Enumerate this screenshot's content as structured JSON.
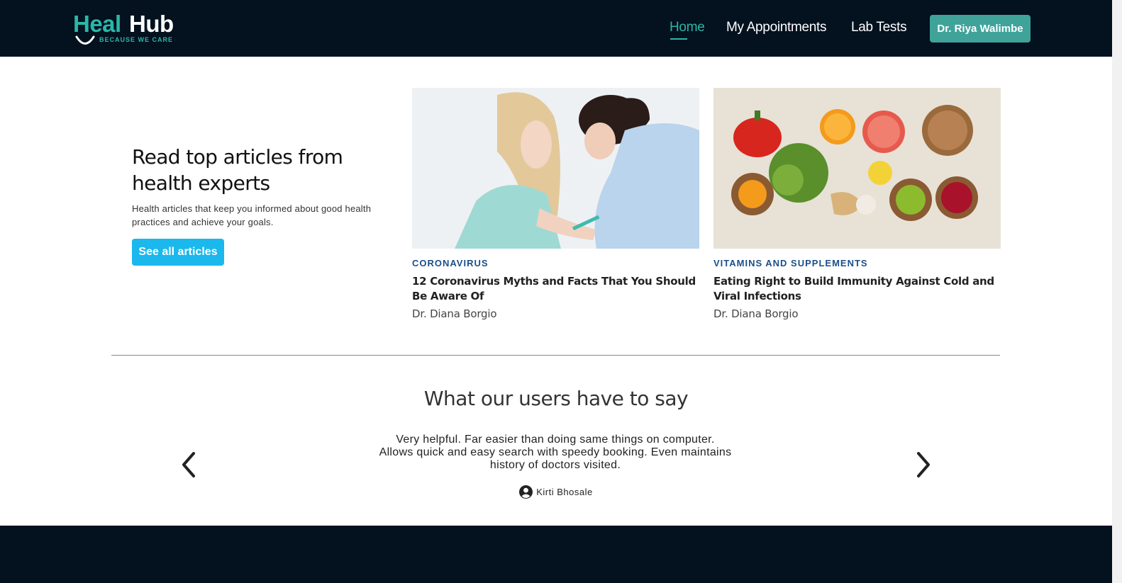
{
  "brand": {
    "name_part1": "Heal",
    "name_part2": "Hub",
    "tagline": "BECAUSE WE CARE",
    "accent_color": "#2bb7a8",
    "dark_color": "#04111f"
  },
  "nav": {
    "items": [
      {
        "label": "Home",
        "active": true
      },
      {
        "label": "My Appointments",
        "active": false
      },
      {
        "label": "Lab Tests",
        "active": false
      }
    ],
    "user_button": "Dr. Riya Walimbe"
  },
  "articles_intro": {
    "title": "Read top articles from health experts",
    "subtitle": "Health articles that keep you informed about good health practices and achieve your goals.",
    "button": "See all articles",
    "button_color": "#1ab8ec"
  },
  "articles": [
    {
      "category": "CORONAVIRUS",
      "title": "12 Coronavirus Myths and Facts That You Should Be Aware Of",
      "author": "Dr. Diana Borgio",
      "image": "nurse-vaccinating-patient-photo"
    },
    {
      "category": "VITAMINS AND SUPPLEMENTS",
      "title": "Eating Right to Build Immunity Against Cold and Viral Infections",
      "author": "Dr. Diana Borgio",
      "image": "healthy-foods-photo"
    }
  ],
  "testimonials": {
    "title": "What our users have to say",
    "quote": "Very helpful. Far easier than doing same things on computer. Allows quick and easy search with speedy booking. Even maintains history of doctors visited.",
    "user": "Kirti Bhosale",
    "prev_icon": "chevron-left-icon",
    "next_icon": "chevron-right-icon"
  }
}
